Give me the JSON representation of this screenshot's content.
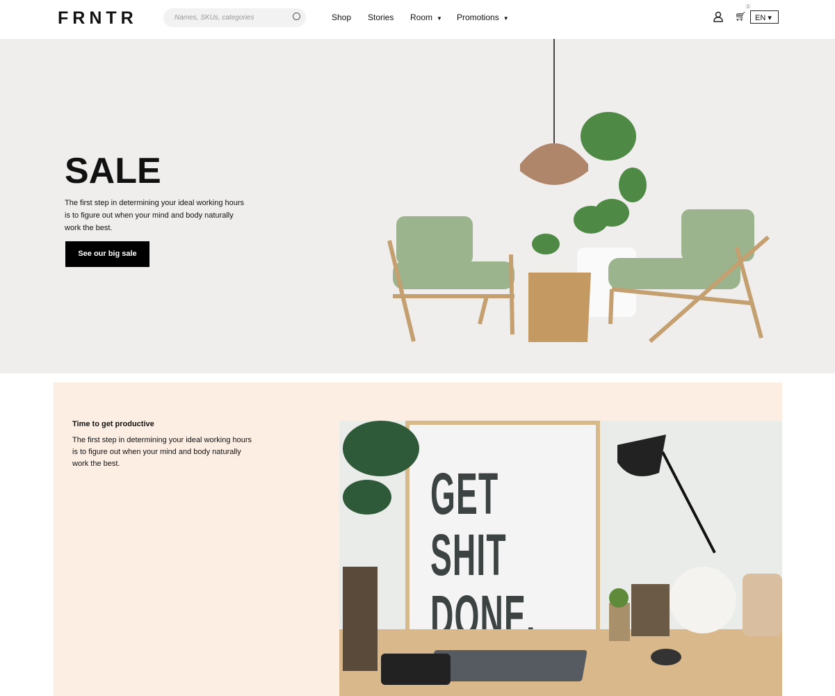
{
  "header": {
    "logo": "FRNTR",
    "search_placeholder": "Names, SKUs, categories",
    "nav": [
      {
        "label": "Shop"
      },
      {
        "label": "Stories"
      },
      {
        "label": "Room",
        "dropdown": true
      },
      {
        "label": "Promotions",
        "dropdown": true
      }
    ],
    "cart_count": "1",
    "language": "EN",
    "caret": "▾"
  },
  "hero": {
    "title": "SALE",
    "text": "The first step in determining your ideal working hours is to figure out when your mind and body naturally work the best.",
    "button": "See our big sale",
    "bg": "#efeeec"
  },
  "section2": {
    "title": "Time to get productive",
    "text": "The first step in determining your ideal working hours is to figure out when your mind and body naturally work the best.",
    "poster_text": "GET SHIT DONE.",
    "bg": "#fdeee4"
  }
}
